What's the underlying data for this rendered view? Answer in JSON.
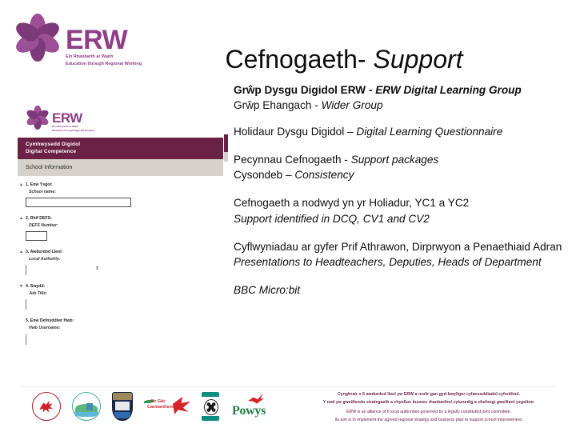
{
  "slide": {
    "title_main": "Cefnogaeth- ",
    "title_italic": "Support"
  },
  "brand": {
    "logo_word": "ERW",
    "logo_tagline_cy": "Ein Rhanbarth ar Waith",
    "logo_tagline_en": "Education through Regional Working",
    "accent_purple": "#6B2146",
    "accent_magenta": "#8E3F88",
    "accent_grey": "#D6D2CB"
  },
  "screenshot": {
    "logo_word": "ERW",
    "logo_tagline_cy": "Ein Rhanbarth ar Waith",
    "logo_tagline_en": "Education through Regional Working",
    "header_cy": "Cymhwysedd Digidol",
    "header_en": "Digital Competence",
    "section_title": "School Information",
    "fields": [
      {
        "caret": "▲",
        "question_cy": "1. Enw Ysgol:",
        "question_en": "School name:",
        "input_kind": "text-wide",
        "value": ""
      },
      {
        "caret": "▲",
        "question_cy": "2. Rhif DEFS:",
        "question_en": "DEFS Number:",
        "input_kind": "text-small",
        "value": ""
      },
      {
        "caret": "▲",
        "question_cy": "3. Awdurdod Lleol:",
        "question_en": "Local Authority:",
        "input_kind": "select",
        "value": "",
        "arrow": "⇕"
      },
      {
        "caret": "▼",
        "question_cy": "4. Swydd:",
        "question_en": "Job Title:",
        "input_kind": "plain",
        "value": ""
      },
      {
        "caret": "",
        "question_cy": "5. Enw Defnyddiwr Hwb:",
        "question_en": "Hwb Username:",
        "input_kind": "plain",
        "value": ""
      }
    ]
  },
  "body": {
    "p1_cy": "Grŵp Dysgu Digidol ERW - ",
    "p1_en": "ERW Digital Learning Group",
    "p2_cy": "Grŵp Ehangach - ",
    "p2_en": "Wider Group",
    "p3_cy": "Holidaur Dysgu Digidol – ",
    "p3_en": "Digital Learning Questionnaire",
    "p4_cy": "Pecynnau Cefnogaeth - ",
    "p4_en": "Support packages",
    "p5_cy": "Cysondeb – ",
    "p5_en": "Consistency",
    "p6_cy": "Cefnogaeth a nodwyd yn yr Holiadur, YC1 a YC2",
    "p6_en": "Support identified in DCQ, CV1 and CV2",
    "p7_cy": "Cyflwyniadau ar gyfer Prif Athrawon, Dirprwyon a Penaethiaid Adran",
    "p7_en": "Presentations to Headteachers, Deputies, Heads of Department",
    "p8_en": "BBC Micro:bit"
  },
  "footer": {
    "partner_logos": [
      {
        "name": "neath-port-talbot",
        "label": "Neath Port Talbot"
      },
      {
        "name": "ceredigion",
        "label": "Ceredigion"
      },
      {
        "name": "pembrokeshire",
        "label": "Pembrokeshire"
      },
      {
        "name": "carmarthenshire",
        "label_cy": "Sir Gâr",
        "label_en": "Carmarthenshire"
      },
      {
        "name": "swansea",
        "label": "Swansea"
      },
      {
        "name": "powys",
        "label": "Powys"
      }
    ],
    "text_cy_line1": "Cynghrair o 6 awdurdod lleol yw ERW a reolir gan gyd-bwyllgor cyfansoddiadol cyfreithiol.",
    "text_cy_line2": "Y nod yw gweithredu strategaeth a chynllun busnes rhanbarthol cytunedig a chefnogi gwelliant ysgolion.",
    "text_en_line1": "ERW is an alliance of 6 local authorities governed by a legally constituted joint committee.",
    "text_en_line2": "Its aim is to implement the agreed regional strategy and business plan to support school improvement."
  }
}
